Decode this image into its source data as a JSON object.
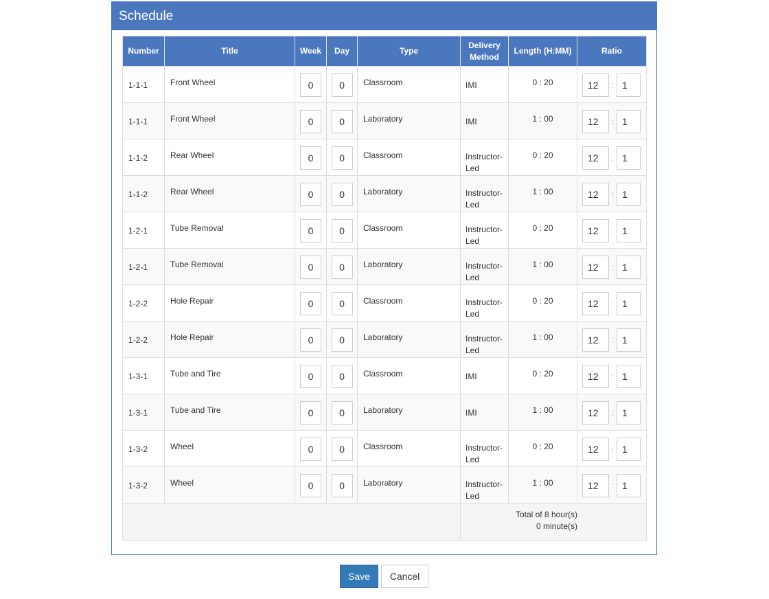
{
  "panel": {
    "title": "Schedule"
  },
  "columns": {
    "number": "Number",
    "title": "Title",
    "week": "Week",
    "day": "Day",
    "type": "Type",
    "delivery_line1": "Delivery",
    "delivery_line2": "Method",
    "length": "Length (H:MM)",
    "ratio": "Ratio"
  },
  "rows": [
    {
      "number": "1-1-1",
      "title": "Front Wheel",
      "week": "0",
      "day": "0",
      "type": "Classroom",
      "method_line1": "IMI",
      "method_line2": "",
      "length": "0 : 20",
      "ratio_left": "12",
      "ratio_right": "1"
    },
    {
      "number": "1-1-1",
      "title": "Front Wheel",
      "week": "0",
      "day": "0",
      "type": "Laboratory",
      "method_line1": "IMI",
      "method_line2": "",
      "length": "1 : 00",
      "ratio_left": "12",
      "ratio_right": "1"
    },
    {
      "number": "1-1-2",
      "title": "Rear Wheel",
      "week": "0",
      "day": "0",
      "type": "Classroom",
      "method_line1": "Instructor-",
      "method_line2": "Led",
      "length": "0 : 20",
      "ratio_left": "12",
      "ratio_right": "1"
    },
    {
      "number": "1-1-2",
      "title": "Rear Wheel",
      "week": "0",
      "day": "0",
      "type": "Laboratory",
      "method_line1": "Instructor-",
      "method_line2": "Led",
      "length": "1 : 00",
      "ratio_left": "12",
      "ratio_right": "1"
    },
    {
      "number": "1-2-1",
      "title": "Tube Removal",
      "week": "0",
      "day": "0",
      "type": "Classroom",
      "method_line1": "Instructor-",
      "method_line2": "Led",
      "length": "0 : 20",
      "ratio_left": "12",
      "ratio_right": "1"
    },
    {
      "number": "1-2-1",
      "title": "Tube Removal",
      "week": "0",
      "day": "0",
      "type": "Laboratory",
      "method_line1": "Instructor-",
      "method_line2": "Led",
      "length": "1 : 00",
      "ratio_left": "12",
      "ratio_right": "1"
    },
    {
      "number": "1-2-2",
      "title": "Hole Repair",
      "week": "0",
      "day": "0",
      "type": "Classroom",
      "method_line1": "Instructor-",
      "method_line2": "Led",
      "length": "0 : 20",
      "ratio_left": "12",
      "ratio_right": "1"
    },
    {
      "number": "1-2-2",
      "title": "Hole Repair",
      "week": "0",
      "day": "0",
      "type": "Laboratory",
      "method_line1": "Instructor-",
      "method_line2": "Led",
      "length": "1 : 00",
      "ratio_left": "12",
      "ratio_right": "1"
    },
    {
      "number": "1-3-1",
      "title": "Tube and Tire",
      "week": "0",
      "day": "0",
      "type": "Classroom",
      "method_line1": "IMI",
      "method_line2": "",
      "length": "0 : 20",
      "ratio_left": "12",
      "ratio_right": "1"
    },
    {
      "number": "1-3-1",
      "title": "Tube and Tire",
      "week": "0",
      "day": "0",
      "type": "Laboratory",
      "method_line1": "IMI",
      "method_line2": "",
      "length": "1 : 00",
      "ratio_left": "12",
      "ratio_right": "1"
    },
    {
      "number": "1-3-2",
      "title": "Wheel",
      "week": "0",
      "day": "0",
      "type": "Classroom",
      "method_line1": "Instructor-",
      "method_line2": "Led",
      "length": "0 : 20",
      "ratio_left": "12",
      "ratio_right": "1"
    },
    {
      "number": "1-3-2",
      "title": "Wheel",
      "week": "0",
      "day": "0",
      "type": "Laboratory",
      "method_line1": "Instructor-",
      "method_line2": "Led",
      "length": "1 : 00",
      "ratio_left": "12",
      "ratio_right": "1"
    }
  ],
  "ratio_separator": ":",
  "footer": {
    "total_hours": "Total of 8 hour(s)",
    "total_minutes": "0 minute(s)"
  },
  "actions": {
    "save_label": "Save",
    "cancel_label": "Cancel"
  },
  "colors": {
    "header_blue": "#4b77be",
    "save_blue": "#337ab7",
    "row_stripe": "#f9f9f9",
    "border": "#dddddd"
  }
}
